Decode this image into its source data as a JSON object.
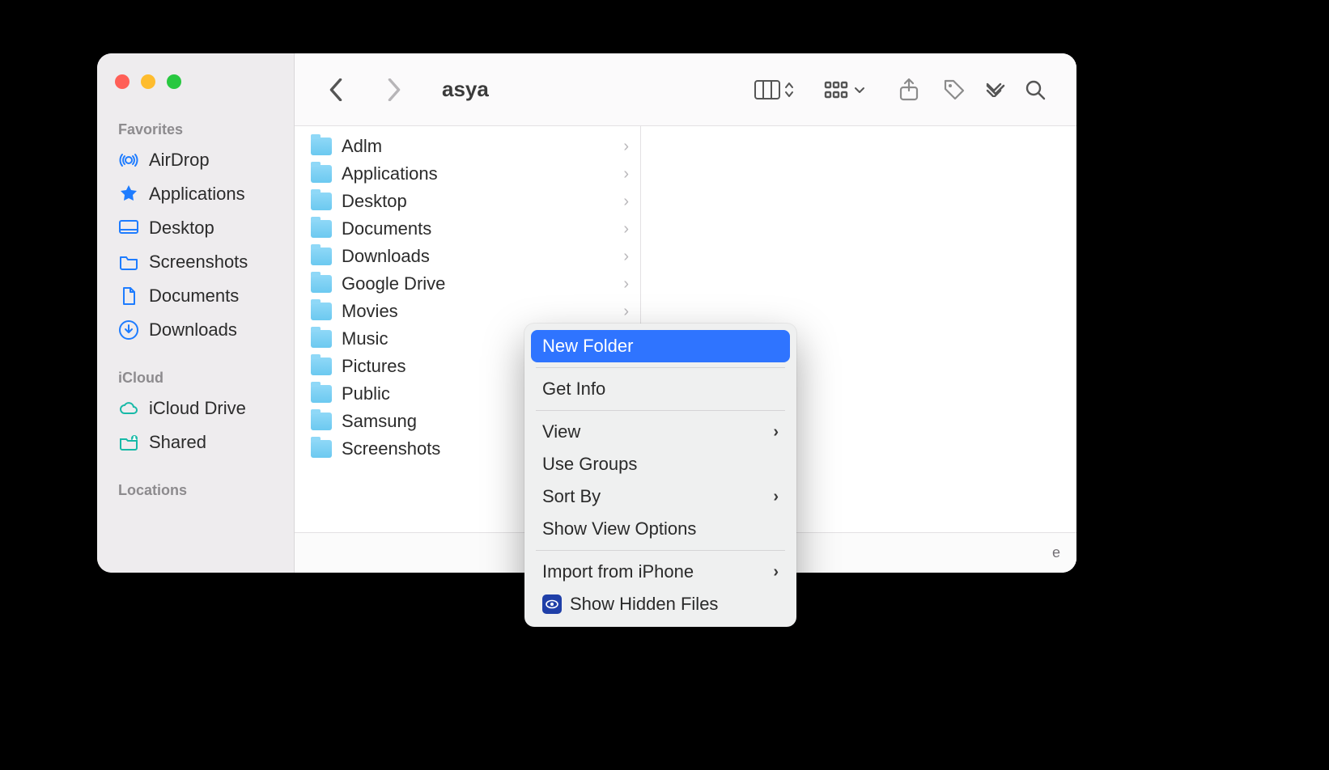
{
  "window_title": "asya",
  "sidebar": {
    "sections": [
      {
        "label": "Favorites",
        "items": [
          {
            "icon": "airdrop",
            "label": "AirDrop"
          },
          {
            "icon": "apps",
            "label": "Applications"
          },
          {
            "icon": "desktop",
            "label": "Desktop"
          },
          {
            "icon": "folder",
            "label": "Screenshots"
          },
          {
            "icon": "doc",
            "label": "Documents"
          },
          {
            "icon": "downloads",
            "label": "Downloads"
          }
        ]
      },
      {
        "label": "iCloud",
        "items": [
          {
            "icon": "cloud",
            "label": "iCloud Drive"
          },
          {
            "icon": "shared",
            "label": "Shared"
          }
        ]
      },
      {
        "label": "Locations",
        "items": []
      }
    ]
  },
  "column_items": [
    "Adlm",
    "Applications",
    "Desktop",
    "Documents",
    "Downloads",
    "Google Drive",
    "Movies",
    "Music",
    "Pictures",
    "Public",
    "Samsung",
    "Screenshots"
  ],
  "status_fragment": "e",
  "context_menu": {
    "groups": [
      [
        {
          "label": "New Folder",
          "highlight": true
        }
      ],
      [
        {
          "label": "Get Info"
        }
      ],
      [
        {
          "label": "View",
          "submenu": true
        },
        {
          "label": "Use Groups"
        },
        {
          "label": "Sort By",
          "submenu": true
        },
        {
          "label": "Show View Options"
        }
      ],
      [
        {
          "label": "Import from iPhone",
          "submenu": true
        },
        {
          "label": "Show Hidden Files",
          "badge": "eye"
        }
      ]
    ]
  }
}
